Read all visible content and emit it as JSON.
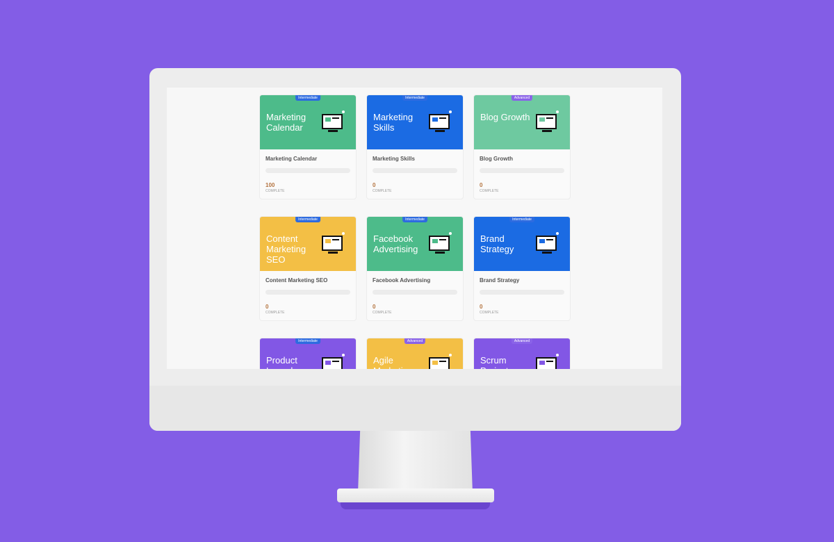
{
  "colors": {
    "background": "#835de6",
    "green": "#4dbb8a",
    "blue": "#1b6be3",
    "light_green": "#6ec9a0",
    "yellow": "#f3bf45",
    "purple": "#8257e5"
  },
  "progress_label": "COMPLETE",
  "courses": [
    {
      "banner_title": "Marketing Calendar",
      "name": "Marketing Calendar",
      "level": "Intermediate",
      "progress": "100",
      "color": "#4dbb8a",
      "badge_color": "#2d6be0",
      "icon": "calendar-illustration-icon"
    },
    {
      "banner_title": "Marketing Skills",
      "name": "Marketing Skills",
      "level": "Intermediate",
      "progress": "0",
      "color": "#1b6be3",
      "badge_color": "#2d6be0",
      "icon": "funnel-illustration-icon"
    },
    {
      "banner_title": "Blog Growth",
      "name": "Blog Growth",
      "level": "Advanced",
      "progress": "0",
      "color": "#6ec9a0",
      "badge_color": "#8a63e8",
      "icon": "house-illustration-icon"
    },
    {
      "banner_title": "Content Marketing SEO",
      "name": "Content Marketing SEO",
      "level": "Intermediate",
      "progress": "0",
      "color": "#f3bf45",
      "badge_color": "#2d6be0",
      "icon": "monitor-search-illustration-icon"
    },
    {
      "banner_title": "Facebook Advertising",
      "name": "Facebook Advertising",
      "level": "Intermediate",
      "progress": "0",
      "color": "#4dbb8a",
      "badge_color": "#2d6be0",
      "icon": "monitor-illustration-icon"
    },
    {
      "banner_title": "Brand Strategy",
      "name": "Brand Strategy",
      "level": "Intermediate",
      "progress": "0",
      "color": "#1b6be3",
      "badge_color": "#2d6be0",
      "icon": "book-illustration-icon"
    },
    {
      "banner_title": "Product Launch",
      "level": "Intermediate",
      "color": "#8257e5",
      "badge_color": "#2d6be0",
      "icon": "rocket-illustration-icon"
    },
    {
      "banner_title": "Agile Marketing",
      "level": "Advanced",
      "color": "#f3bf45",
      "badge_color": "#8a63e8",
      "icon": "cone-illustration-icon"
    },
    {
      "banner_title": "Scrum Project Management",
      "level": "Advanced",
      "color": "#8257e5",
      "badge_color": "#8a63e8",
      "icon": "hand-illustration-icon"
    }
  ]
}
